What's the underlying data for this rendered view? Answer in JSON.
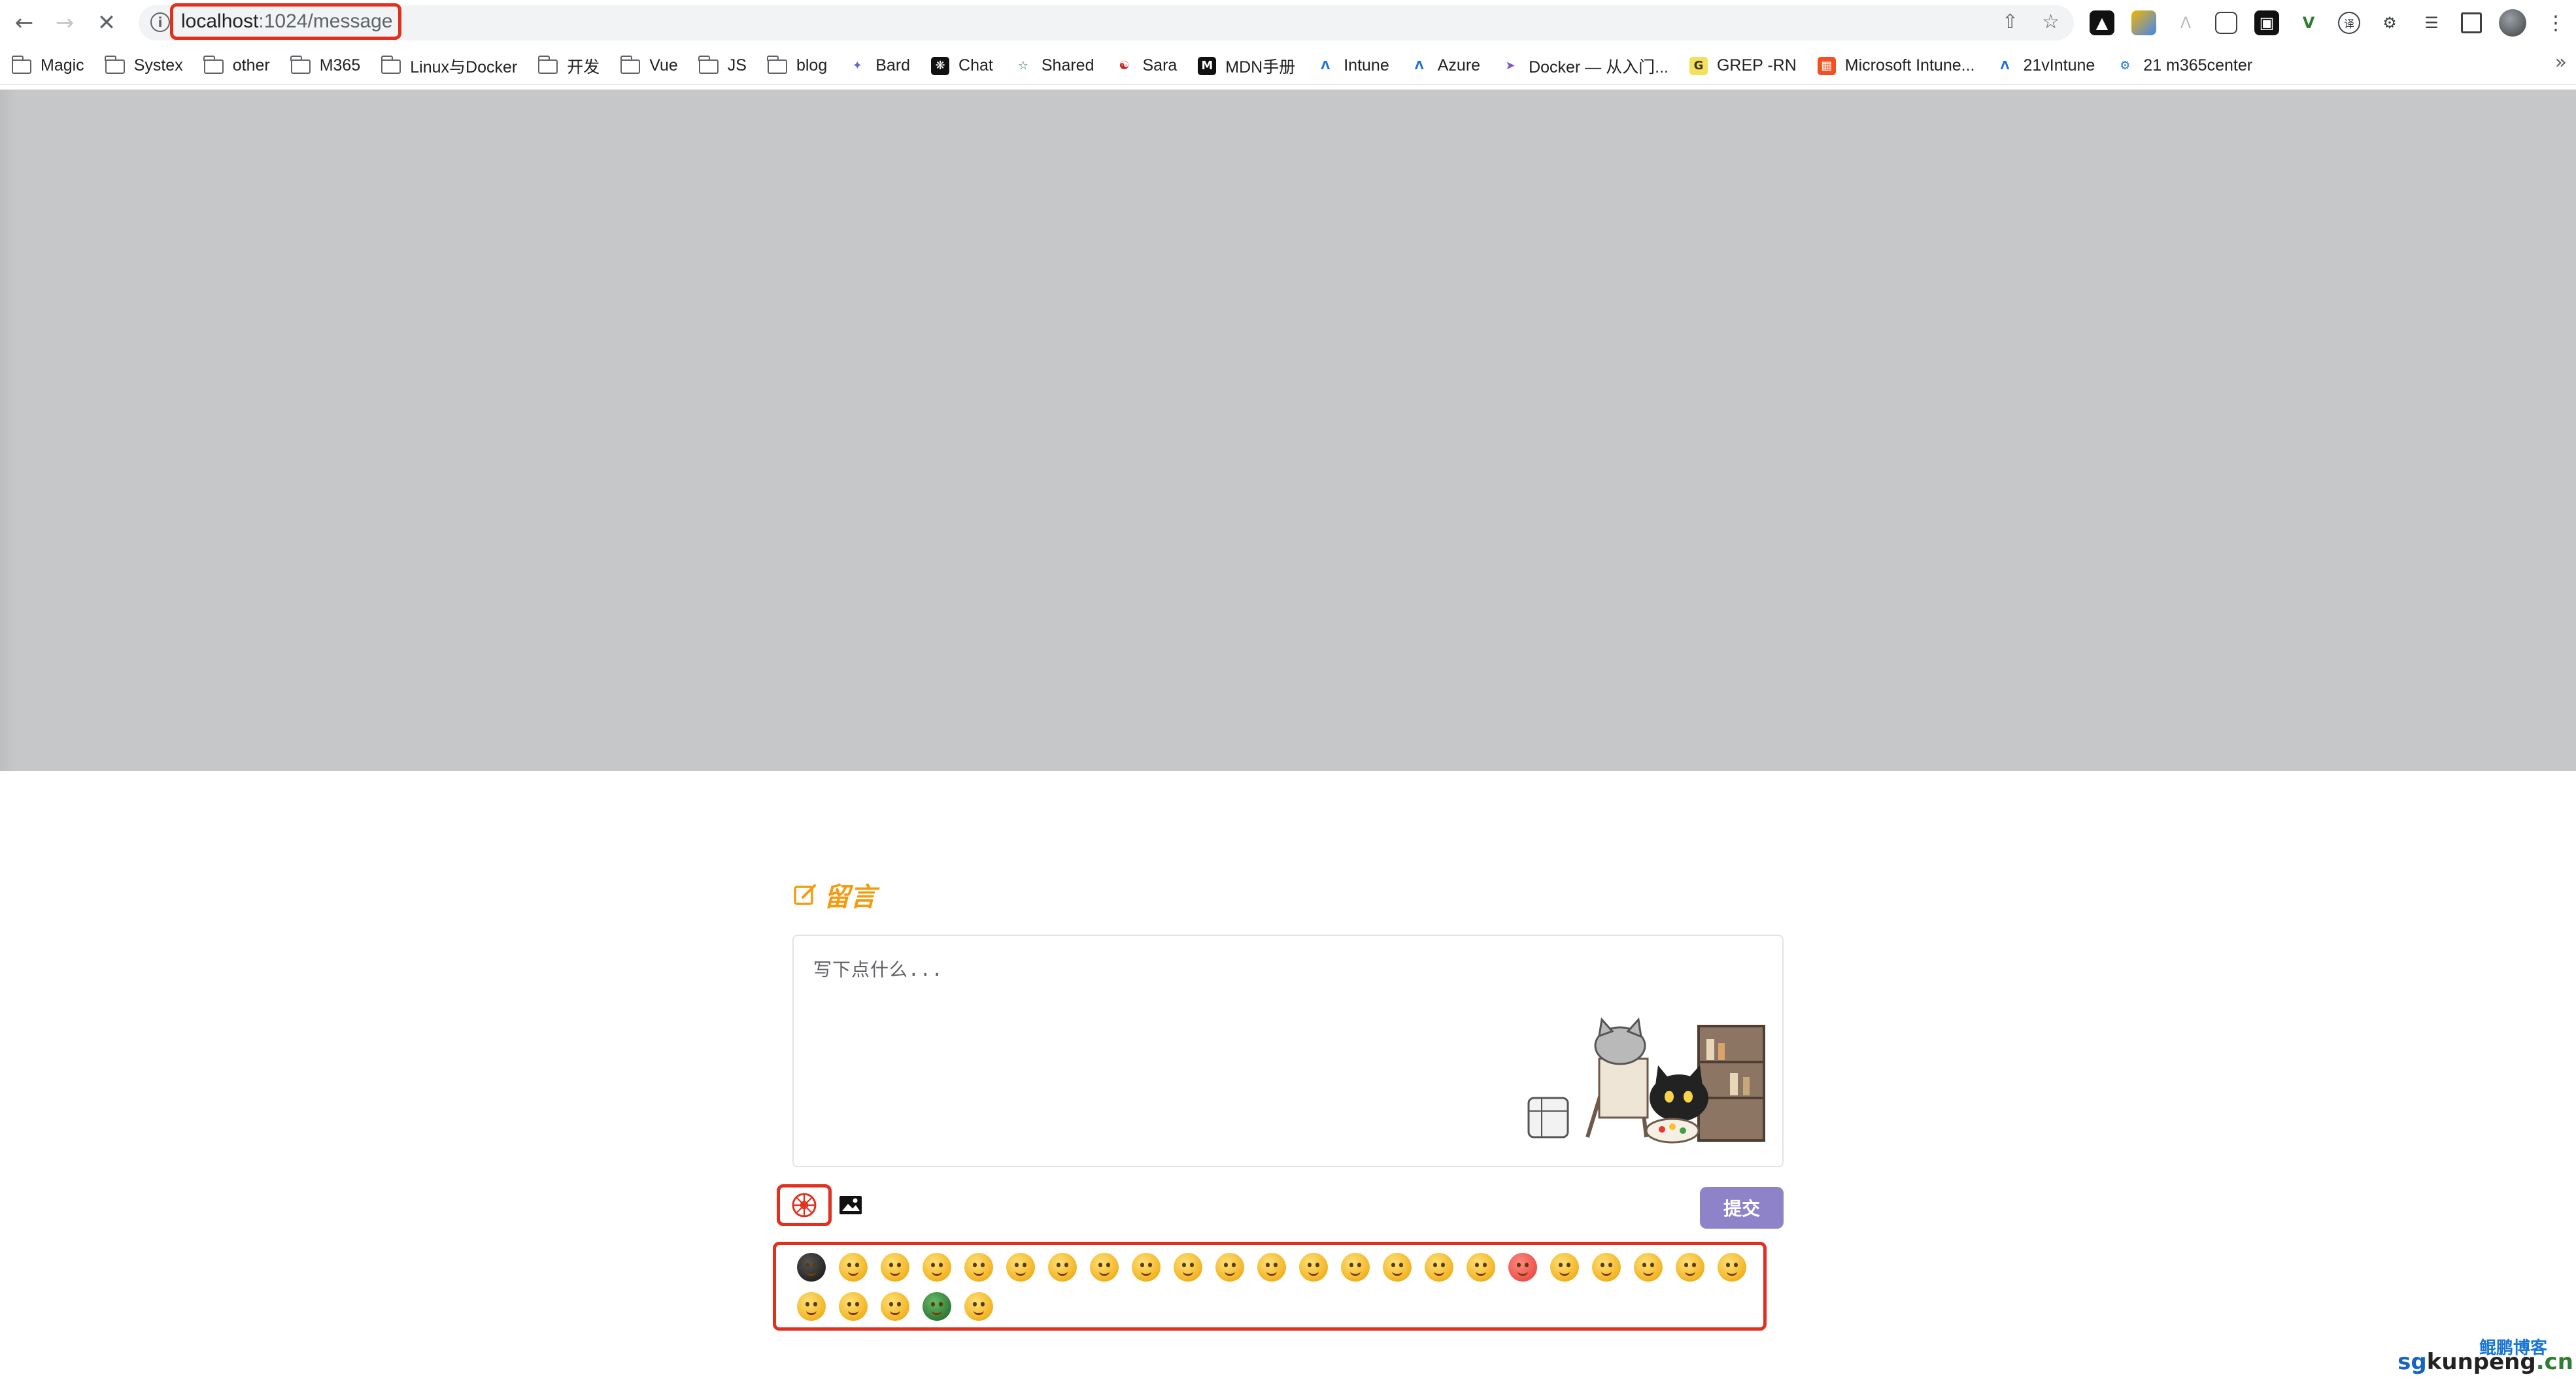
{
  "browser": {
    "url_host": "localhost",
    "url_path": ":1024/message",
    "bookmarks": [
      {
        "label": "Magic",
        "type": "folder"
      },
      {
        "label": "Systex",
        "type": "folder"
      },
      {
        "label": "other",
        "type": "folder"
      },
      {
        "label": "M365",
        "type": "folder"
      },
      {
        "label": "Linux与Docker",
        "type": "folder"
      },
      {
        "label": "开发",
        "type": "folder"
      },
      {
        "label": "Vue",
        "type": "folder"
      },
      {
        "label": "JS",
        "type": "folder"
      },
      {
        "label": "blog",
        "type": "folder"
      },
      {
        "label": "Bard",
        "type": "site",
        "icon": "sparkle-icon"
      },
      {
        "label": "Chat",
        "type": "site",
        "icon": "openai-icon"
      },
      {
        "label": "Shared",
        "type": "site",
        "icon": "star-outline-icon"
      },
      {
        "label": "Sara",
        "type": "site",
        "icon": "figure-icon"
      },
      {
        "label": "MDN手册",
        "type": "site",
        "icon": "mdn-icon"
      },
      {
        "label": "Intune",
        "type": "site",
        "icon": "azure-icon"
      },
      {
        "label": "Azure",
        "type": "site",
        "icon": "azure-icon"
      },
      {
        "label": "Docker — 从入门...",
        "type": "site",
        "icon": "rocket-icon"
      },
      {
        "label": "GREP -RN",
        "type": "site",
        "icon": "grep-icon"
      },
      {
        "label": "Microsoft Intune...",
        "type": "site",
        "icon": "microsoft-icon"
      },
      {
        "label": "21vIntune",
        "type": "site",
        "icon": "azure-icon"
      },
      {
        "label": "21 m365center",
        "type": "site",
        "icon": "gear-icon"
      }
    ]
  },
  "page": {
    "section_title": "留言",
    "textarea_placeholder": "写下点什么...",
    "submit_label": "提交",
    "emoji_count": 28
  },
  "watermark": {
    "top": "鲲鹏博客",
    "main_sg": "sg",
    "main_k": "kunpeng",
    "main_cn": ".cn"
  },
  "colors": {
    "accent_title": "#f39c12",
    "highlight_box": "#e0301e",
    "submit_bg": "#8e83c9",
    "banner": "#c6c7c9"
  }
}
